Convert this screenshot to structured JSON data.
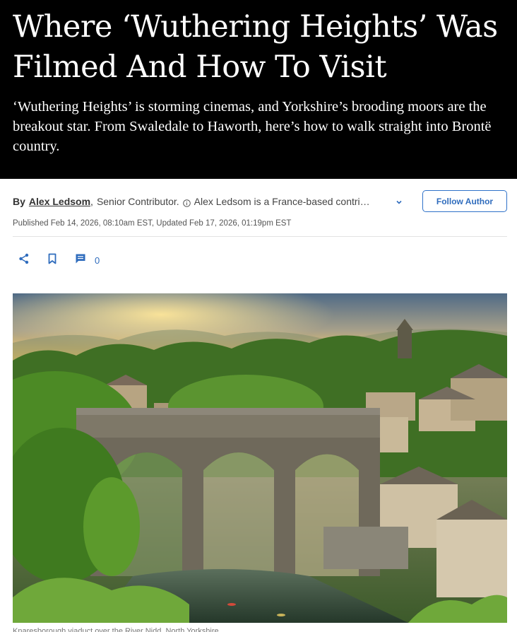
{
  "article": {
    "headline": "Where ‘Wuthering Heights’ Was Filmed And How To Visit",
    "dek": "‘Wuthering Heights’ is storming cinemas, and Yorkshire’s brooding moors are the breakout star. From Swaledale to Haworth, here’s how to walk straight into Brontë country."
  },
  "byline": {
    "by_label": "By",
    "author": "Alex Ledsom",
    "comma": ",",
    "role": "Senior Contributor.",
    "bio": "Alex Ledsom is a France-based contributor who writes about travel."
  },
  "follow_button": "Follow Author",
  "dates": "Published Feb 14, 2026, 08:10am EST, Updated Feb 17, 2026, 01:19pm EST",
  "actions": {
    "comment_count": "0"
  },
  "colors": {
    "hero_bg": "#000000",
    "accent": "#2f6cbd"
  },
  "icons": {
    "info": "info-icon",
    "expand": "chevron-down-icon",
    "share": "share-icon",
    "save": "bookmark-icon",
    "comments": "comment-icon"
  },
  "caption": "Knaresborough viaduct over the River Nidd, North Yorkshire"
}
